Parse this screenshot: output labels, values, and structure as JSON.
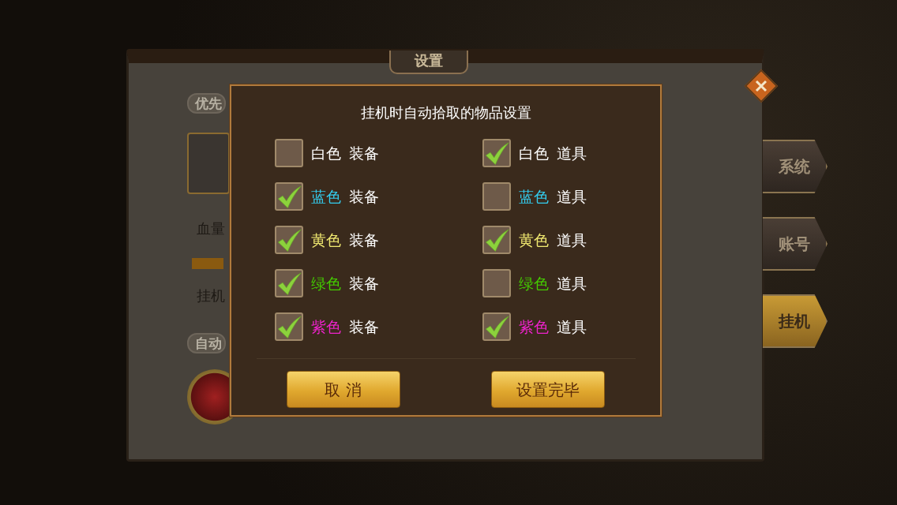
{
  "background_panel": {
    "title": "设置",
    "fragments": [
      {
        "kind": "header",
        "text": "优先"
      },
      {
        "kind": "item_icon"
      },
      {
        "kind": "text",
        "text": "血量"
      },
      {
        "kind": "bar"
      },
      {
        "kind": "text",
        "text": "挂机"
      },
      {
        "kind": "header",
        "text": "自动"
      },
      {
        "kind": "round_icon"
      }
    ]
  },
  "side_tabs": [
    {
      "label": "系统",
      "selected": false
    },
    {
      "label": "账号",
      "selected": false
    },
    {
      "label": "挂机",
      "selected": true
    }
  ],
  "dialog": {
    "title": "挂机时自动拾取的物品设置",
    "options": [
      {
        "color_label": "白色",
        "category": "装备",
        "color": "#ffffff",
        "checked": false
      },
      {
        "color_label": "白色",
        "category": "道具",
        "color": "#ffffff",
        "checked": true
      },
      {
        "color_label": "蓝色",
        "category": "装备",
        "color": "#33ccee",
        "checked": true
      },
      {
        "color_label": "蓝色",
        "category": "道具",
        "color": "#33ccee",
        "checked": false
      },
      {
        "color_label": "黄色",
        "category": "装备",
        "color": "#f0e870",
        "checked": true
      },
      {
        "color_label": "黄色",
        "category": "道具",
        "color": "#f0e870",
        "checked": true
      },
      {
        "color_label": "绿色",
        "category": "装备",
        "color": "#44cc00",
        "checked": true
      },
      {
        "color_label": "绿色",
        "category": "道具",
        "color": "#44cc00",
        "checked": false
      },
      {
        "color_label": "紫色",
        "category": "装备",
        "color": "#ee22cc",
        "checked": true
      },
      {
        "color_label": "紫色",
        "category": "道具",
        "color": "#ee22cc",
        "checked": true
      }
    ],
    "buttons": [
      {
        "label": "取 消"
      },
      {
        "label": "设置完毕"
      }
    ]
  }
}
